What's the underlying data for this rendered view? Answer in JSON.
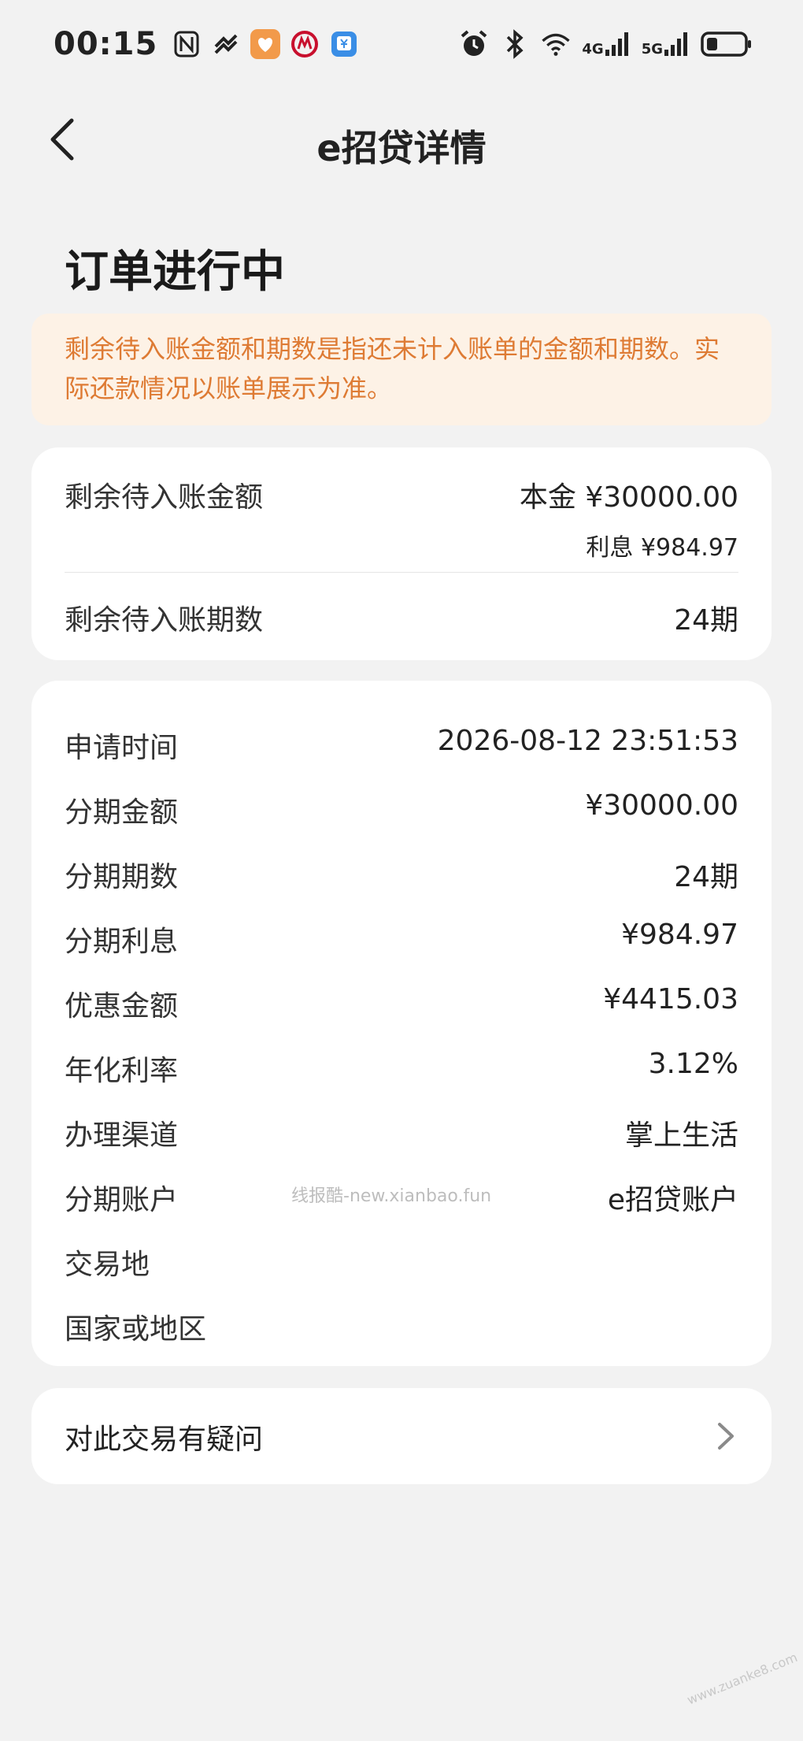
{
  "status_bar": {
    "time": "00:15",
    "network_4g": "4G",
    "network_5g": "5G",
    "icons": [
      "nfc-icon",
      "sync-icon",
      "health-app-icon",
      "cmb-app-icon",
      "bank-app-icon",
      "alarm-icon",
      "bluetooth-icon",
      "wifi-icon",
      "signal-icon",
      "battery-icon"
    ],
    "accent_colors": {
      "health": "#f29a4a",
      "cmb": "#c8102e",
      "bank": "#3a8ee6"
    }
  },
  "nav": {
    "title": "e招贷详情",
    "back_icon": "chevron-left-icon"
  },
  "order_status": "订单进行中",
  "notice": {
    "text": "剩余待入账金额和期数是指还未计入账单的金额和期数。实际还款情况以账单展示为准。",
    "color": "#de7b34",
    "background": "#fdf2e6"
  },
  "pending": {
    "amount_label": "剩余待入账金额",
    "principal": "本金 ¥30000.00",
    "interest": "利息 ¥984.97",
    "periods_label": "剩余待入账期数",
    "periods_value": "24期"
  },
  "details": [
    {
      "label": "申请时间",
      "value": "2026-08-12 23:51:53"
    },
    {
      "label": "分期金额",
      "value": "¥30000.00"
    },
    {
      "label": "分期期数",
      "value": "24期"
    },
    {
      "label": "分期利息",
      "value": "¥984.97"
    },
    {
      "label": "优惠金额",
      "value": "¥4415.03"
    },
    {
      "label": "年化利率",
      "value": "3.12%"
    },
    {
      "label": "办理渠道",
      "value": "掌上生活"
    },
    {
      "label": "分期账户",
      "value": "e招贷账户"
    },
    {
      "label": "交易地",
      "value": ""
    },
    {
      "label": "国家或地区",
      "value": ""
    }
  ],
  "query": {
    "label": "对此交易有疑问",
    "icon": "chevron-right-icon"
  },
  "watermark": "线报酷-new.xianbao.fun",
  "corner_watermark": "www.zuanke8.com"
}
